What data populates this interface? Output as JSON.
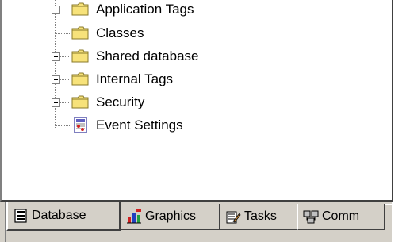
{
  "tree": {
    "items": [
      {
        "label": "Application Tags",
        "icon": "folder-icon",
        "expandable": true
      },
      {
        "label": "Classes",
        "icon": "folder-icon",
        "expandable": false
      },
      {
        "label": "Shared database",
        "icon": "folder-icon",
        "expandable": true
      },
      {
        "label": "Internal Tags",
        "icon": "folder-icon",
        "expandable": true
      },
      {
        "label": "Security",
        "icon": "folder-icon",
        "expandable": true
      },
      {
        "label": "Event Settings",
        "icon": "event-settings-icon",
        "expandable": false
      }
    ]
  },
  "tabs": [
    {
      "label": "Database",
      "icon": "database-icon",
      "active": true
    },
    {
      "label": "Graphics",
      "icon": "graphics-icon",
      "active": false
    },
    {
      "label": "Tasks",
      "icon": "tasks-icon",
      "active": false
    },
    {
      "label": "Comm",
      "icon": "comm-icon",
      "active": false
    }
  ],
  "colors": {
    "folder": "#f7e27a",
    "folder_outline": "#8a7a2a",
    "chrome": "#d4d0c8"
  }
}
